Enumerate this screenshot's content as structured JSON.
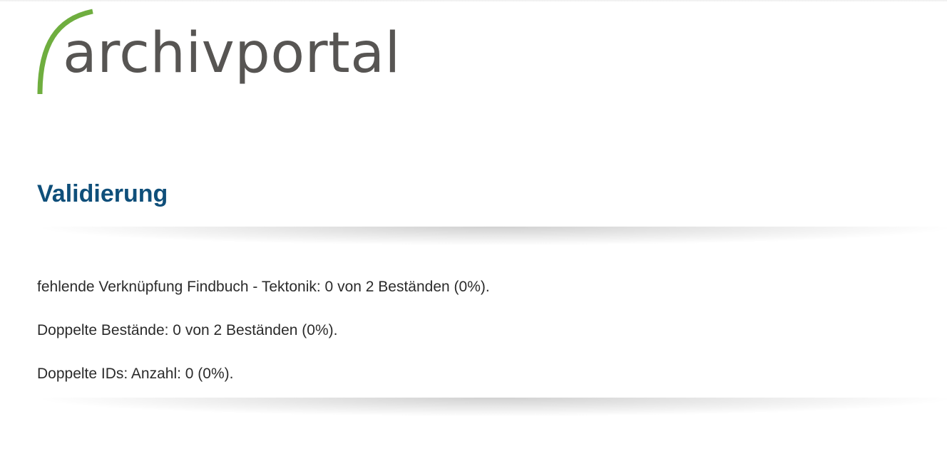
{
  "header": {
    "logo_text": "archivportal",
    "logo_arc_color": "#6fae3f",
    "logo_text_color": "#575553"
  },
  "main": {
    "title": "Validierung",
    "title_color": "#0f4f7a",
    "validation_results": [
      "fehlende Verknüpfung Findbuch - Tektonik: 0 von 2 Beständen (0%).",
      "Doppelte Bestände: 0 von 2 Beständen (0%).",
      "Doppelte IDs: Anzahl: 0 (0%)."
    ]
  }
}
